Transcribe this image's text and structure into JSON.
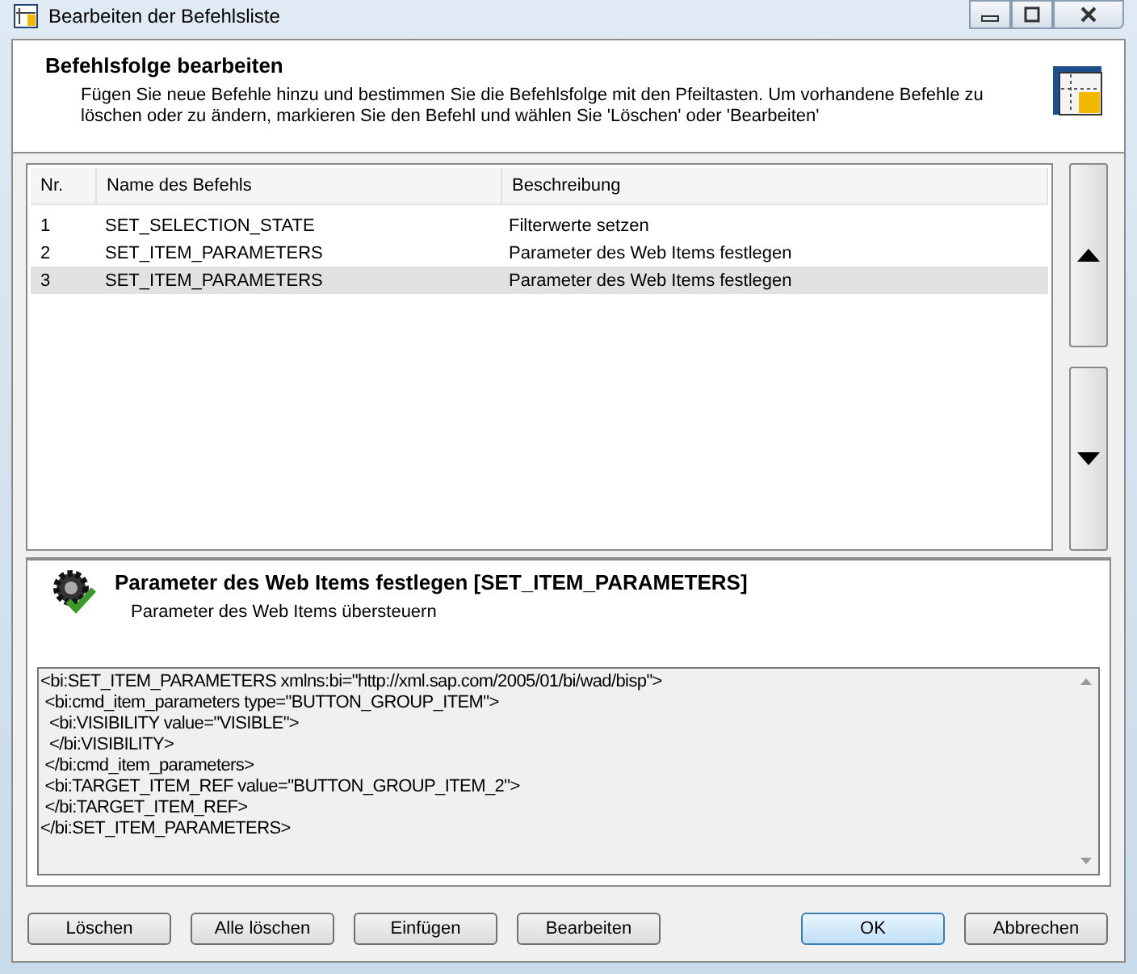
{
  "window": {
    "title": "Bearbeiten der Befehlsliste"
  },
  "header": {
    "title": "Befehlsfolge bearbeiten",
    "description": "Fügen Sie neue Befehle hinzu und bestimmen Sie die Befehlsfolge mit den Pfeiltasten. Um vorhandene Befehle zu löschen oder zu ändern, markieren Sie den Befehl und wählen Sie 'Löschen' oder 'Bearbeiten'"
  },
  "table": {
    "columns": [
      "Nr.",
      "Name des Befehls",
      "Beschreibung"
    ],
    "rows": [
      {
        "cells": [
          "1",
          "SET_SELECTION_STATE",
          "Filterwerte setzen"
        ],
        "selected": false
      },
      {
        "cells": [
          "2",
          "SET_ITEM_PARAMETERS",
          "Parameter des Web Items festlegen"
        ],
        "selected": false
      },
      {
        "cells": [
          "3",
          "SET_ITEM_PARAMETERS",
          "Parameter des Web Items festlegen"
        ],
        "selected": true
      }
    ]
  },
  "detail": {
    "title": "Parameter des Web Items festlegen [SET_ITEM_PARAMETERS]",
    "subtitle": "Parameter des Web Items übersteuern",
    "xml_lines": [
      "<bi:SET_ITEM_PARAMETERS xmlns:bi=\"http://xml.sap.com/2005/01/bi/wad/bisp\">",
      " <bi:cmd_item_parameters type=\"BUTTON_GROUP_ITEM\">",
      "  <bi:VISIBILITY value=\"VISIBLE\">",
      "  </bi:VISIBILITY>",
      " </bi:cmd_item_parameters>",
      " <bi:TARGET_ITEM_REF value=\"BUTTON_GROUP_ITEM_2\">",
      " </bi:TARGET_ITEM_REF>",
      "</bi:SET_ITEM_PARAMETERS>"
    ]
  },
  "buttons": [
    {
      "label": "Löschen",
      "default": false
    },
    {
      "label": "Alle löschen",
      "default": false
    },
    {
      "label": "Einfügen",
      "default": false
    },
    {
      "label": "Bearbeiten",
      "default": false
    },
    {
      "label": "OK",
      "default": true
    },
    {
      "label": "Abbrechen",
      "default": false
    }
  ]
}
